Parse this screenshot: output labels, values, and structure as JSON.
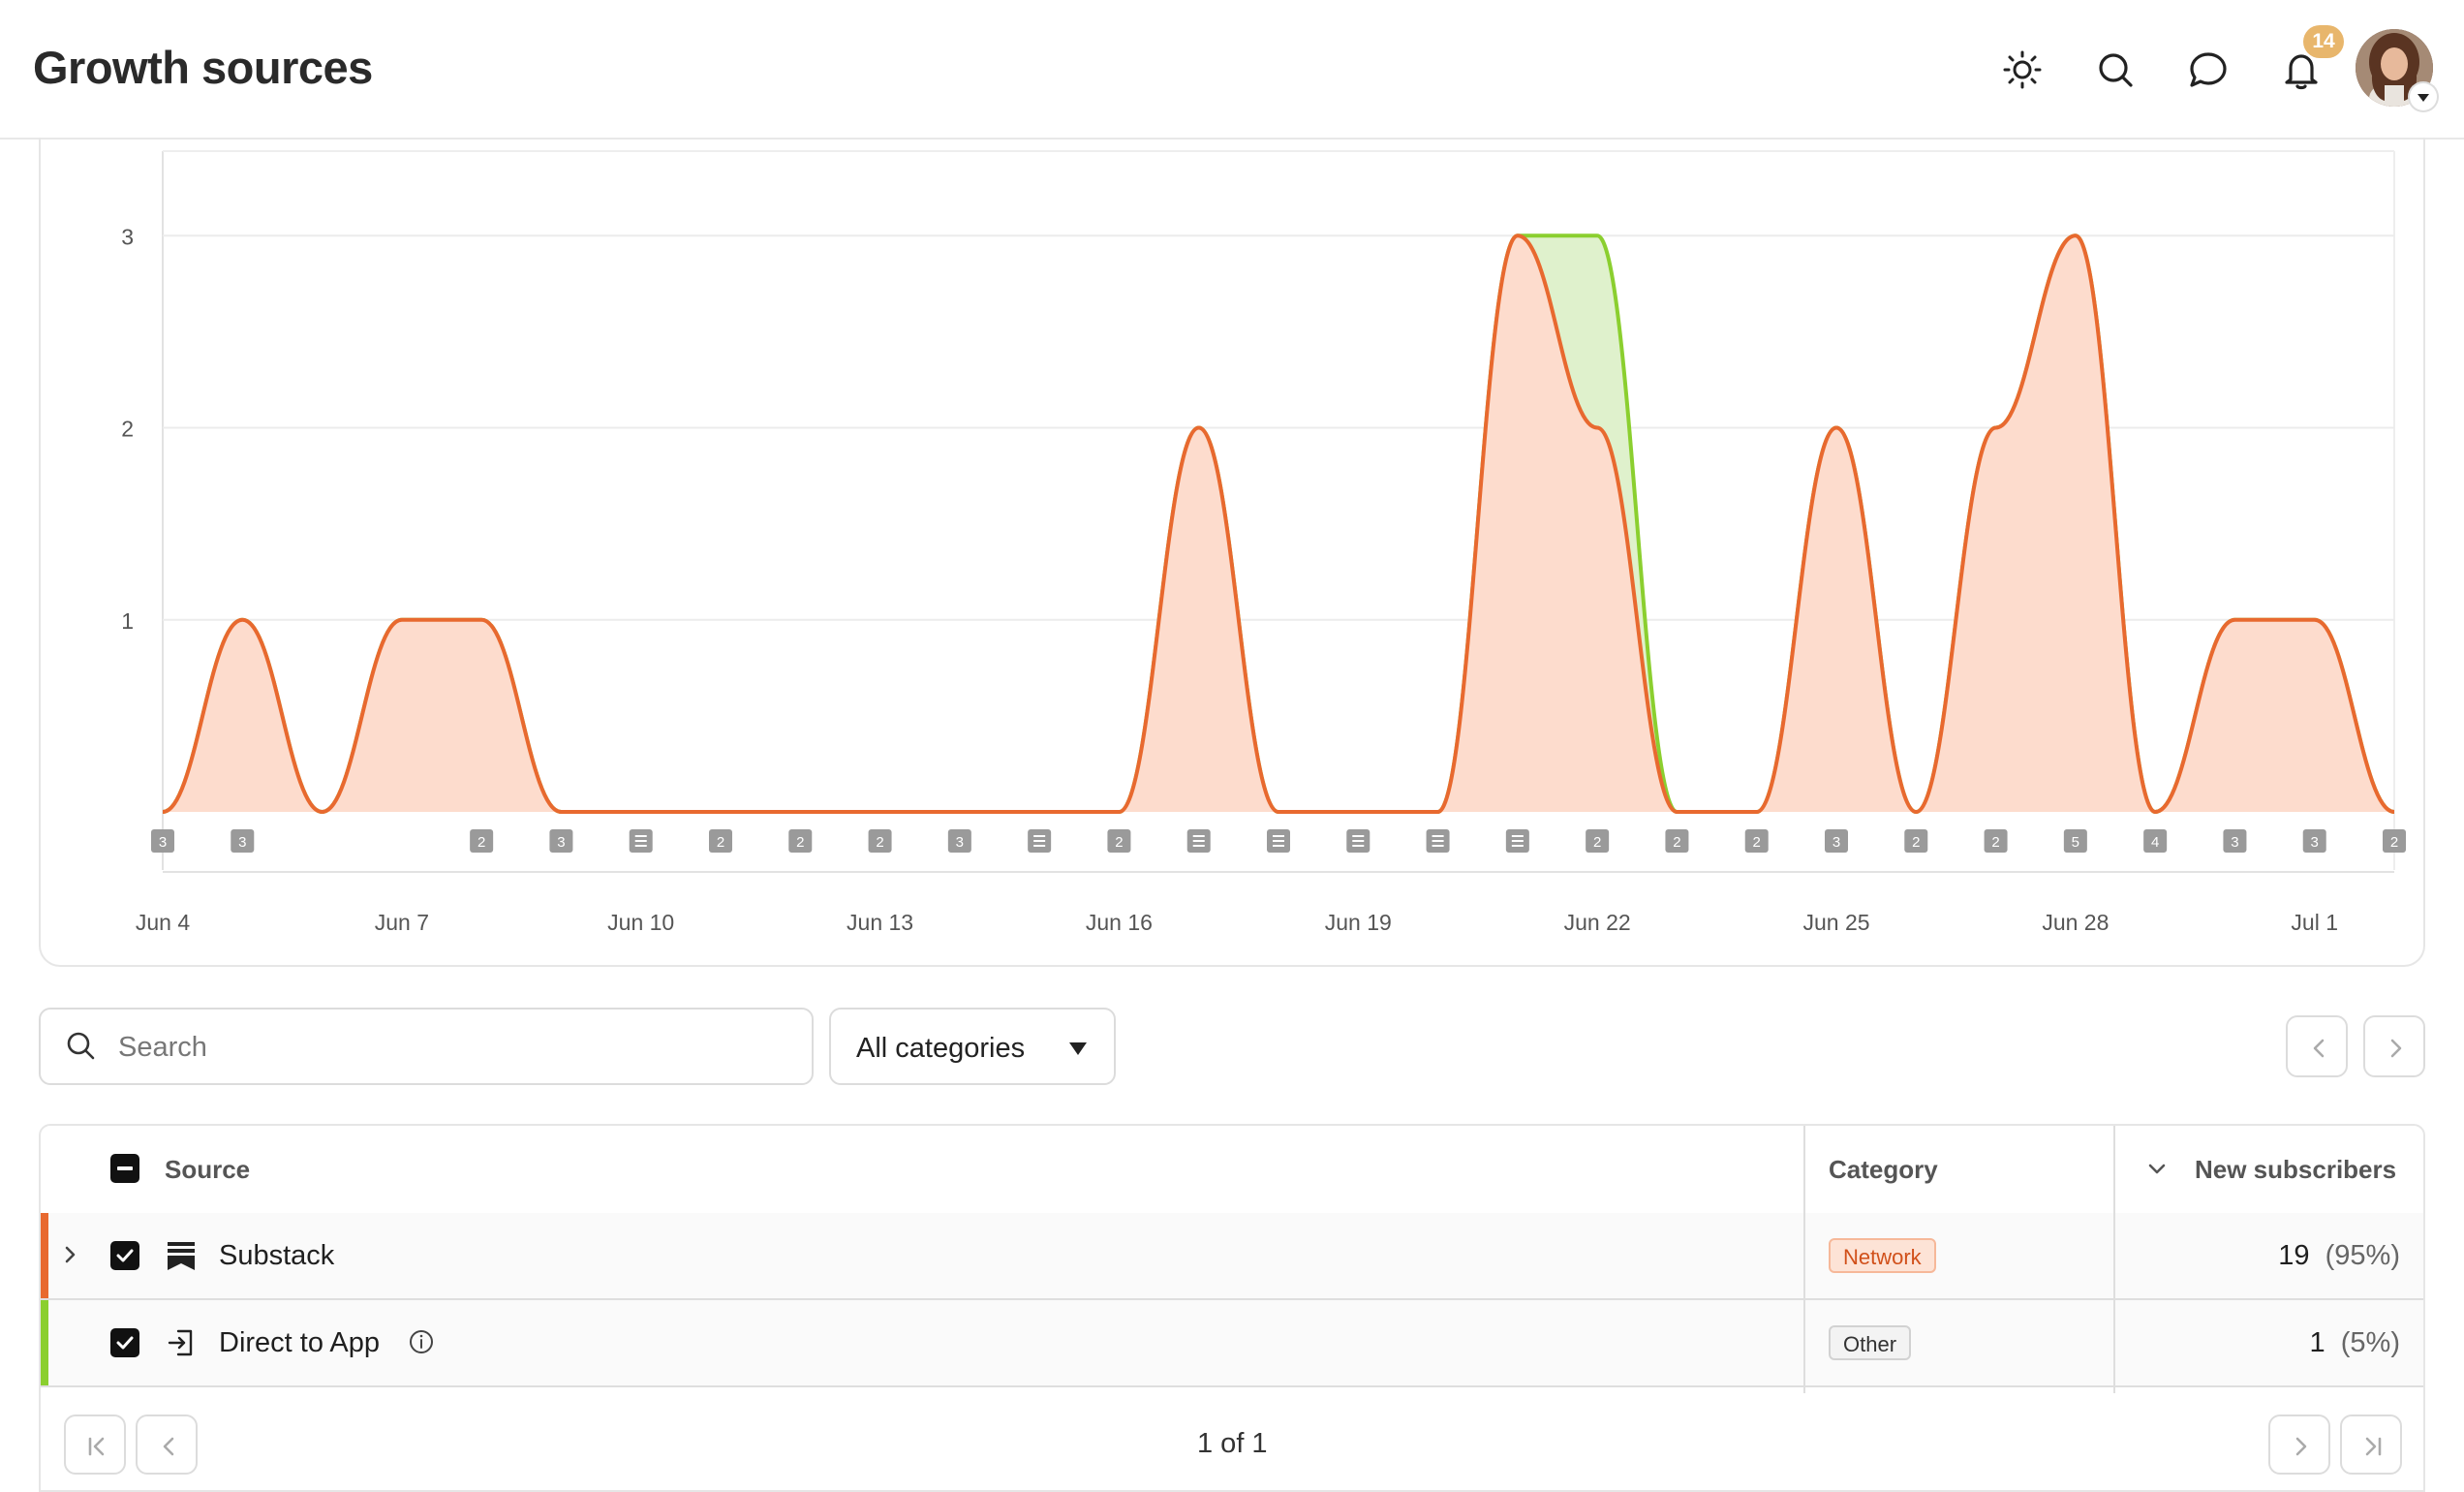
{
  "header": {
    "title": "Growth sources",
    "icons": [
      "sun-icon",
      "search-icon",
      "chat-icon",
      "bell-icon"
    ],
    "notification_count": "14"
  },
  "chart_data": {
    "type": "area",
    "x_ticks": [
      "Jun 4",
      "Jun 7",
      "Jun 10",
      "Jun 13",
      "Jun 16",
      "Jun 19",
      "Jun 22",
      "Jun 25",
      "Jun 28",
      "Jul 1"
    ],
    "y_ticks": [
      "1",
      "2",
      "3"
    ],
    "ylim": [
      0,
      3.4
    ],
    "grid": true,
    "x": [
      "Jun 4",
      "Jun 5",
      "Jun 6",
      "Jun 7",
      "Jun 8",
      "Jun 9",
      "Jun 10",
      "Jun 11",
      "Jun 12",
      "Jun 13",
      "Jun 14",
      "Jun 15",
      "Jun 16",
      "Jun 17",
      "Jun 18",
      "Jun 19",
      "Jun 20",
      "Jun 21",
      "Jun 22",
      "Jun 23",
      "Jun 24",
      "Jun 25",
      "Jun 26",
      "Jun 27",
      "Jun 28",
      "Jun 29",
      "Jun 30",
      "Jul 1",
      "Jul 2"
    ],
    "series": [
      {
        "color": "#e8692f",
        "values": [
          0,
          1,
          0,
          1,
          1,
          0,
          0,
          0,
          0,
          0,
          0,
          0,
          0,
          2,
          0,
          0,
          0,
          3,
          2,
          0,
          0,
          2,
          0,
          2,
          3,
          0,
          1,
          1,
          0
        ]
      },
      {
        "color": "#8bcf2f",
        "values": [
          0,
          0,
          0,
          0,
          0,
          0,
          0,
          0,
          0,
          0,
          0,
          0,
          0,
          0,
          0,
          0,
          0,
          0,
          1,
          0,
          0,
          0,
          0,
          0,
          0,
          0,
          0,
          0,
          0
        ]
      }
    ],
    "annotations": [
      {
        "date": "Jun 4",
        "label": "3"
      },
      {
        "date": "Jun 5",
        "label": "3"
      },
      {
        "date": "Jun 8",
        "label": "2"
      },
      {
        "date": "Jun 9",
        "label": "3"
      },
      {
        "date": "Jun 10",
        "label": "post"
      },
      {
        "date": "Jun 11",
        "label": "2"
      },
      {
        "date": "Jun 12",
        "label": "2"
      },
      {
        "date": "Jun 13",
        "label": "2"
      },
      {
        "date": "Jun 14",
        "label": "3"
      },
      {
        "date": "Jun 15",
        "label": "post"
      },
      {
        "date": "Jun 16",
        "label": "2"
      },
      {
        "date": "Jun 17",
        "label": "post"
      },
      {
        "date": "Jun 18",
        "label": "post"
      },
      {
        "date": "Jun 19",
        "label": "post"
      },
      {
        "date": "Jun 20",
        "label": "post"
      },
      {
        "date": "Jun 21",
        "label": "post"
      },
      {
        "date": "Jun 22",
        "label": "2"
      },
      {
        "date": "Jun 23",
        "label": "2"
      },
      {
        "date": "Jun 24",
        "label": "2"
      },
      {
        "date": "Jun 25",
        "label": "3"
      },
      {
        "date": "Jun 26",
        "label": "2"
      },
      {
        "date": "Jun 27",
        "label": "2"
      },
      {
        "date": "Jun 28",
        "label": "5"
      },
      {
        "date": "Jun 29",
        "label": "4"
      },
      {
        "date": "Jun 30",
        "label": "3"
      },
      {
        "date": "Jul 1",
        "label": "3"
      },
      {
        "date": "Jul 2",
        "label": "2"
      }
    ]
  },
  "filters": {
    "search_placeholder": "Search",
    "category_value": "All categories"
  },
  "table": {
    "headers": {
      "source": "Source",
      "category": "Category",
      "new_subscribers": "New subscribers"
    },
    "rows": [
      {
        "source": "Substack",
        "category": "Network",
        "count": "19",
        "pct": "(95%)",
        "accent": "#e8692f",
        "tag_bg": "#fde3d6",
        "tag_border": "#f6b899",
        "tag_color": "#d1501a"
      },
      {
        "source": "Direct to App",
        "category": "Other",
        "count": "1",
        "pct": "(5%)",
        "accent": "#8bcf2f",
        "tag_bg": "#f3f3f3",
        "tag_border": "#d2d2d2",
        "tag_color": "#333333"
      }
    ]
  },
  "pagination": {
    "label": "1 of 1"
  }
}
